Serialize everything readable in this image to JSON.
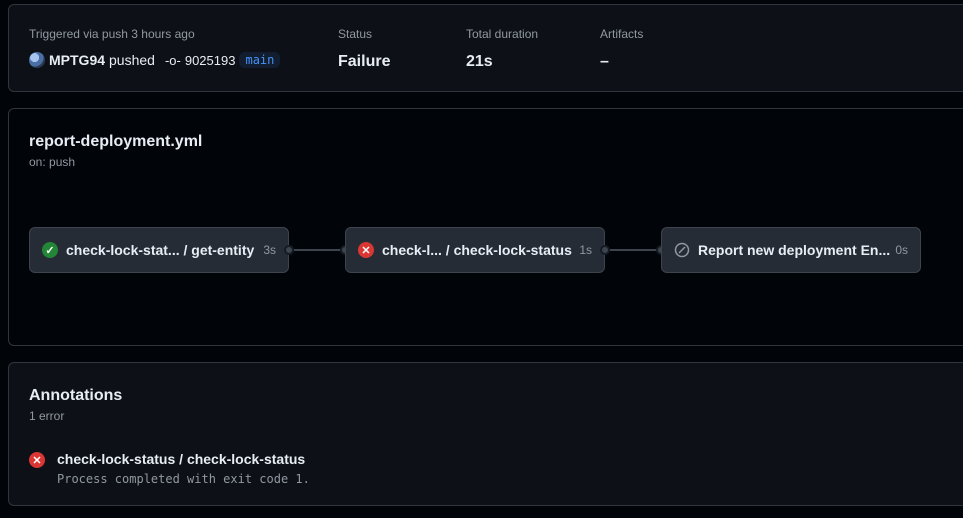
{
  "summary": {
    "trigger_text": "Triggered via push 3 hours ago",
    "user": "MPTG94",
    "action": "pushed",
    "commit_sha": "9025193",
    "branch": "main",
    "status_label": "Status",
    "status_value": "Failure",
    "duration_label": "Total duration",
    "duration_value": "21s",
    "artifacts_label": "Artifacts",
    "artifacts_value": "–"
  },
  "workflow": {
    "file": "report-deployment.yml",
    "trigger": "on: push",
    "jobs": [
      {
        "name": "check-lock-stat... / get-entity",
        "duration": "3s",
        "status": "success"
      },
      {
        "name": "check-l... / check-lock-status",
        "duration": "1s",
        "status": "failure"
      },
      {
        "name": "Report new deployment En...",
        "duration": "0s",
        "status": "skipped"
      }
    ]
  },
  "annotations": {
    "title": "Annotations",
    "count": "1 error",
    "items": [
      {
        "job": "check-lock-status / check-lock-status",
        "message": "Process completed with exit code 1."
      }
    ]
  },
  "colors": {
    "success": "#238636",
    "failure": "#da3633",
    "branch_text": "#4493f8"
  }
}
